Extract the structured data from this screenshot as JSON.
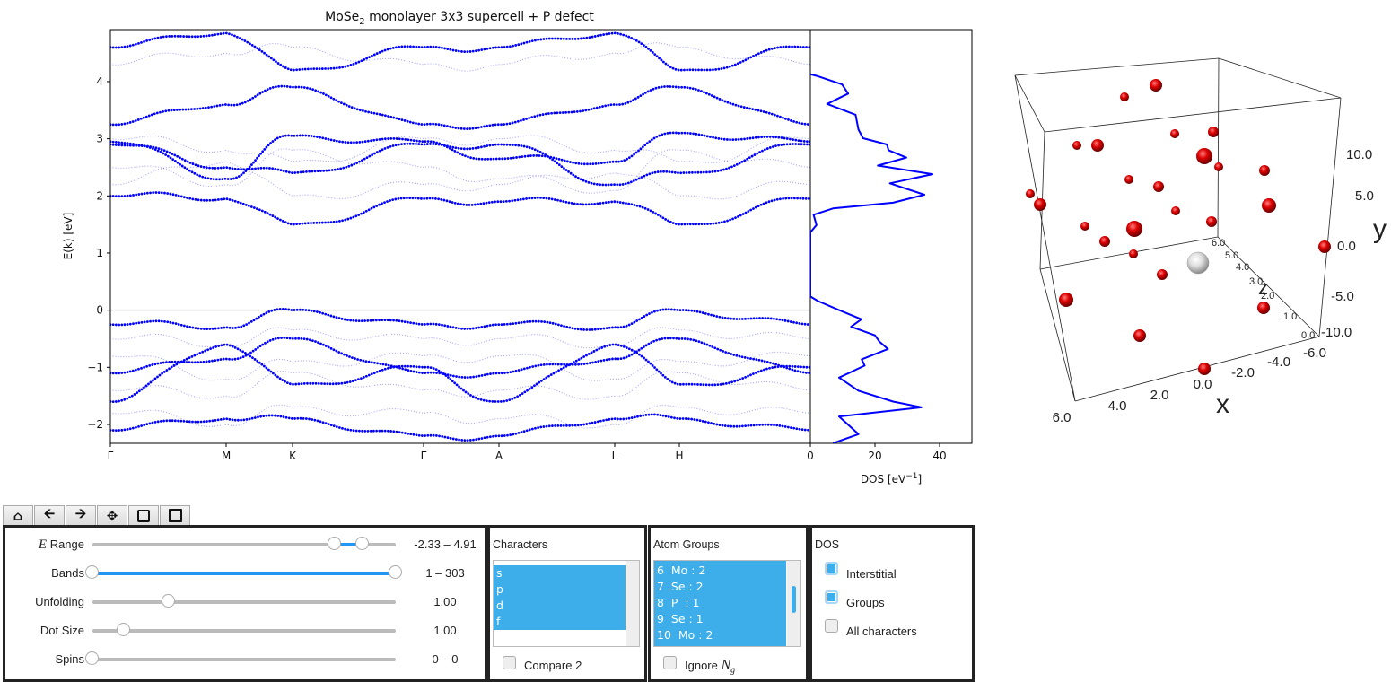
{
  "chart_data": [
    {
      "type": "scatter",
      "title": "MoSe₂ monolayer 3x3 supercell + P defect",
      "title_main": "MoSe",
      "title_sub": "2",
      "title_rest": " monolayer 3x3 supercell + P defect",
      "ylabel": "E(k) [eV]",
      "xlabel": "",
      "ylim": [
        -2.33,
        4.91
      ],
      "yticks": [
        "4",
        "3",
        "2",
        "1",
        "0",
        "−1",
        "−2"
      ],
      "ytick_values": [
        4,
        3,
        2,
        1,
        0,
        -1,
        -2
      ],
      "kpath_labels": [
        "Γ",
        "M",
        "K",
        "Γ",
        "A",
        "L",
        "H",
        ""
      ],
      "fermi_level": 0,
      "marker_color": "#0000ff",
      "bands_heavy": [
        [
          4.6,
          4.85,
          4.2,
          4.6,
          4.6,
          4.85,
          4.2,
          4.6
        ],
        [
          3.25,
          3.6,
          3.9,
          3.25,
          3.25,
          3.6,
          3.9,
          3.25
        ],
        [
          2.95,
          2.3,
          3.05,
          2.95,
          2.65,
          2.6,
          3.1,
          2.95
        ],
        [
          2.9,
          2.5,
          2.4,
          2.9,
          2.9,
          2.2,
          2.4,
          2.9
        ],
        [
          2.0,
          1.95,
          1.5,
          1.95,
          1.9,
          1.9,
          1.5,
          1.95
        ],
        [
          -0.25,
          -0.3,
          0.0,
          -0.25,
          -0.25,
          -0.3,
          0.0,
          -0.25
        ],
        [
          -1.1,
          -0.85,
          -0.5,
          -1.1,
          -1.1,
          -0.85,
          -0.5,
          -1.1
        ],
        [
          -1.6,
          -0.6,
          -1.3,
          -1.0,
          -1.6,
          -0.6,
          -1.3,
          -1.0
        ],
        [
          -2.1,
          -1.9,
          -1.9,
          -2.2,
          -2.2,
          -1.9,
          -1.9,
          -2.1
        ]
      ],
      "bands_faint": [
        [
          4.3,
          4.5,
          4.6,
          4.3,
          4.3,
          4.5,
          4.6,
          4.3
        ],
        [
          3.0,
          2.8,
          2.6,
          3.0,
          3.0,
          2.8,
          2.6,
          3.0
        ],
        [
          2.5,
          2.2,
          2.8,
          2.5,
          2.3,
          2.1,
          2.8,
          2.5
        ],
        [
          2.2,
          2.6,
          2.0,
          2.2,
          2.2,
          2.4,
          2.0,
          2.2
        ],
        [
          -0.5,
          -0.6,
          -0.35,
          -0.5,
          -0.5,
          -0.6,
          -0.35,
          -0.5
        ],
        [
          -0.8,
          -1.2,
          -0.9,
          -0.8,
          -0.8,
          -1.2,
          -0.9,
          -0.8
        ],
        [
          -1.4,
          -1.5,
          -1.1,
          -1.4,
          -1.4,
          -1.5,
          -1.1,
          -1.4
        ],
        [
          -1.8,
          -2.0,
          -1.7,
          -1.8,
          -1.9,
          -2.0,
          -1.7,
          -1.8
        ]
      ]
    },
    {
      "type": "line",
      "title": "",
      "xlabel": "DOS [eV⁻¹]",
      "xlabel_main": "DOS [eV",
      "xlabel_sup": "−1",
      "xlabel_end": "]",
      "xlim": [
        0,
        50
      ],
      "xticks": [
        "0",
        "20",
        "40"
      ],
      "xtick_values": [
        0,
        20,
        40
      ],
      "ylim": [
        -2.33,
        4.91
      ],
      "line_color": "#0000ff",
      "points": [
        [
          -2.33,
          7
        ],
        [
          -2.17,
          14.9
        ],
        [
          -1.86,
          8.9
        ],
        [
          -1.7,
          34.4
        ],
        [
          -1.6,
          25.6
        ],
        [
          -1.41,
          14.9
        ],
        [
          -1.18,
          8.9
        ],
        [
          -0.97,
          16.8
        ],
        [
          -0.86,
          15.9
        ],
        [
          -0.68,
          24
        ],
        [
          -0.55,
          21.4
        ],
        [
          -0.44,
          20
        ],
        [
          -0.29,
          12.6
        ],
        [
          -0.16,
          15.8
        ],
        [
          0.0,
          8.9
        ],
        [
          0.16,
          2.4
        ],
        [
          0.24,
          0
        ],
        [
          1.36,
          0
        ],
        [
          1.49,
          1.9
        ],
        [
          1.67,
          1
        ],
        [
          1.78,
          7
        ],
        [
          1.88,
          25.6
        ],
        [
          2.02,
          35.3
        ],
        [
          2.22,
          24.6
        ],
        [
          2.38,
          37.8
        ],
        [
          2.53,
          20.9
        ],
        [
          2.67,
          29.7
        ],
        [
          2.8,
          24.2
        ],
        [
          2.9,
          23.7
        ],
        [
          3.01,
          16.3
        ],
        [
          3.16,
          14.9
        ],
        [
          3.42,
          14
        ],
        [
          3.61,
          5.2
        ],
        [
          3.79,
          11.7
        ],
        [
          3.95,
          9.8
        ],
        [
          4.1,
          2
        ],
        [
          4.13,
          0
        ]
      ]
    }
  ],
  "viewer3d": {
    "axis_labels": {
      "x": "x",
      "y": "y",
      "z": "z"
    },
    "x_ticks": [
      "6.0",
      "4.0",
      "2.0",
      "0.0",
      "-2.0",
      "-4.0",
      "-6.0"
    ],
    "y_ticks": [
      "10.0",
      "5.0",
      "0.0",
      "-5.0",
      "-10.0"
    ],
    "z_ticks": [
      "6.0",
      "5.0",
      "4.0",
      "3.0",
      "2.0",
      "1.0",
      "0.0"
    ],
    "atom_color": "#dd0000",
    "defect_color": "#e0e0e0"
  },
  "toolbar": {
    "home": "home-icon",
    "back": "arrow-left-icon",
    "forward": "arrow-right-icon",
    "pan": "move-icon",
    "zoom": "zoom-rect-icon",
    "save": "save-icon"
  },
  "controls": {
    "e_range": {
      "label_italic": "E",
      "label": " Range",
      "value": "-2.33 – 4.91",
      "low": 0.8,
      "high": 0.89
    },
    "bands": {
      "label": "Bands",
      "value": "1 – 303",
      "low": 0.0,
      "high": 1.0
    },
    "unfolding": {
      "label": "Unfolding",
      "value": "1.00",
      "pos": 0.25
    },
    "dot_size": {
      "label": "Dot Size",
      "value": "1.00",
      "pos": 0.105
    },
    "spins": {
      "label": "Spins",
      "value": "0 – 0",
      "pos": 0.0
    }
  },
  "characters": {
    "title": "Characters",
    "items": [
      "s",
      "p",
      "d",
      "f"
    ],
    "compare_label": "Compare 2",
    "compare_checked": false
  },
  "atom_groups": {
    "title": "Atom Groups",
    "items": [
      "6  Mo : 2",
      "7  Se : 2",
      "8  P  : 1",
      "9  Se : 1",
      "10  Mo : 2"
    ],
    "ignore_label": "Ignore ",
    "ignore_math": "N",
    "ignore_sub": "g",
    "ignore_checked": false
  },
  "dos": {
    "title": "DOS",
    "options": [
      {
        "label": "Interstitial",
        "checked": true
      },
      {
        "label": "Groups",
        "checked": true
      },
      {
        "label": "All characters",
        "checked": false
      }
    ]
  }
}
